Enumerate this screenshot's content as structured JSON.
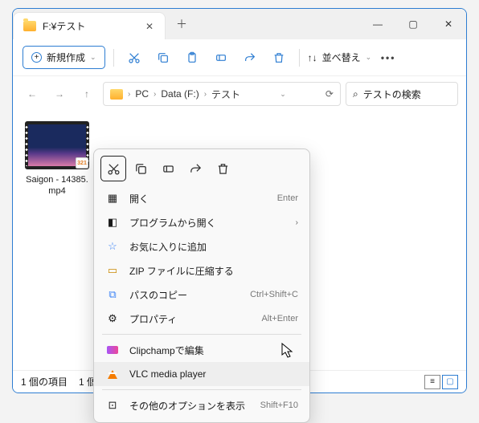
{
  "tab": {
    "title": "F:¥テスト"
  },
  "toolbar": {
    "new_label": "新規作成",
    "sort_label": "並べ替え"
  },
  "breadcrumbs": [
    "PC",
    "Data (F:)",
    "テスト"
  ],
  "search": {
    "placeholder": "テストの検索"
  },
  "file": {
    "name": "Saigon - 14385.mp4"
  },
  "status": {
    "items": "1 個の項目",
    "selected": "1 個の"
  },
  "ctx": {
    "open": "開く",
    "open_sc": "Enter",
    "openwith": "プログラムから開く",
    "fav": "お気に入りに追加",
    "zip": "ZIP ファイルに圧縮する",
    "copypath": "パスのコピー",
    "copypath_sc": "Ctrl+Shift+C",
    "prop": "プロパティ",
    "prop_sc": "Alt+Enter",
    "clip": "Clipchampで編集",
    "vlc": "VLC media player",
    "more": "その他のオプションを表示",
    "more_sc": "Shift+F10"
  }
}
